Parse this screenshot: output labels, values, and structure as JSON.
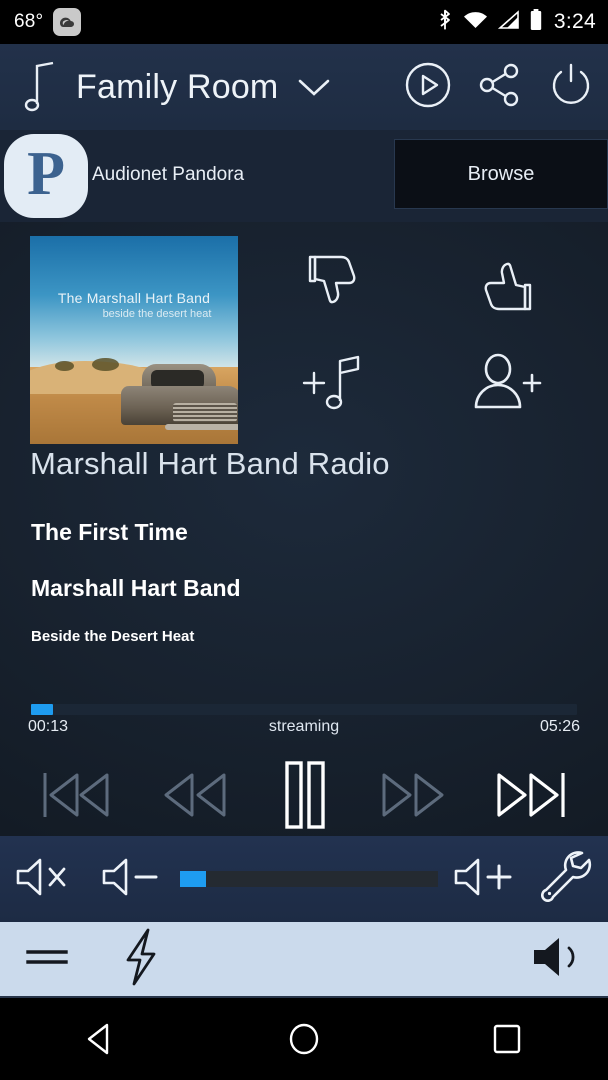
{
  "statusbar": {
    "temperature": "68°",
    "time": "3:24",
    "weather_icon": "weather-icon",
    "bluetooth_icon": "bluetooth-icon",
    "wifi_icon": "wifi-icon",
    "signal_icon": "cellular-signal-icon",
    "battery_icon": "battery-icon"
  },
  "header": {
    "note_icon": "music-note-icon",
    "room": "Family Room",
    "chevron_icon": "chevron-down-icon",
    "play_icon": "play-circle-icon",
    "share_icon": "share-icon",
    "power_icon": "power-icon"
  },
  "source": {
    "logo_letter": "P",
    "logo_name": "pandora-logo",
    "label": "Audionet Pandora",
    "browse_label": "Browse"
  },
  "nowplaying": {
    "album_art_title": "The Marshall Hart Band",
    "album_art_subtitle": "beside the desert heat",
    "station": "Marshall Hart Band Radio",
    "track": "The First Time",
    "artist": "Marshall Hart Band",
    "album": "Beside the Desert Heat",
    "elapsed": "00:13",
    "status": "streaming",
    "duration": "05:26",
    "progress_percent": 4,
    "actions": [
      {
        "name": "thumbs-down-button",
        "label": "thumbs-down-icon"
      },
      {
        "name": "thumbs-up-button",
        "label": "thumbs-up-icon"
      },
      {
        "name": "add-to-playlist-button",
        "label": "add-music-note-icon"
      },
      {
        "name": "add-person-button",
        "label": "add-person-icon"
      }
    ],
    "transport": [
      {
        "name": "previous-track-button",
        "icon": "skip-previous-icon",
        "state": "dim"
      },
      {
        "name": "rewind-button",
        "icon": "rewind-icon",
        "state": "dim"
      },
      {
        "name": "pause-button",
        "icon": "pause-icon",
        "state": "active"
      },
      {
        "name": "fast-forward-button",
        "icon": "fast-forward-icon",
        "state": "dim"
      },
      {
        "name": "next-track-button",
        "icon": "skip-next-icon",
        "state": "active"
      }
    ]
  },
  "volume": {
    "mute_icon": "volume-mute-icon",
    "down_icon": "volume-down-icon",
    "up_icon": "volume-up-icon",
    "settings_icon": "wrench-icon",
    "level_percent": 10
  },
  "bottombar": {
    "menu_icon": "menu-icon",
    "flash_icon": "lightning-bolt-icon",
    "speaker_icon": "speaker-icon"
  },
  "androidnav": {
    "back_icon": "back-triangle-icon",
    "home_icon": "home-circle-icon",
    "recents_icon": "recents-square-icon"
  },
  "colors": {
    "accent_blue": "#1e9cf0",
    "header_navy": "#22314a",
    "body_navy": "#1a2533",
    "light_bar": "#cbdaec"
  }
}
